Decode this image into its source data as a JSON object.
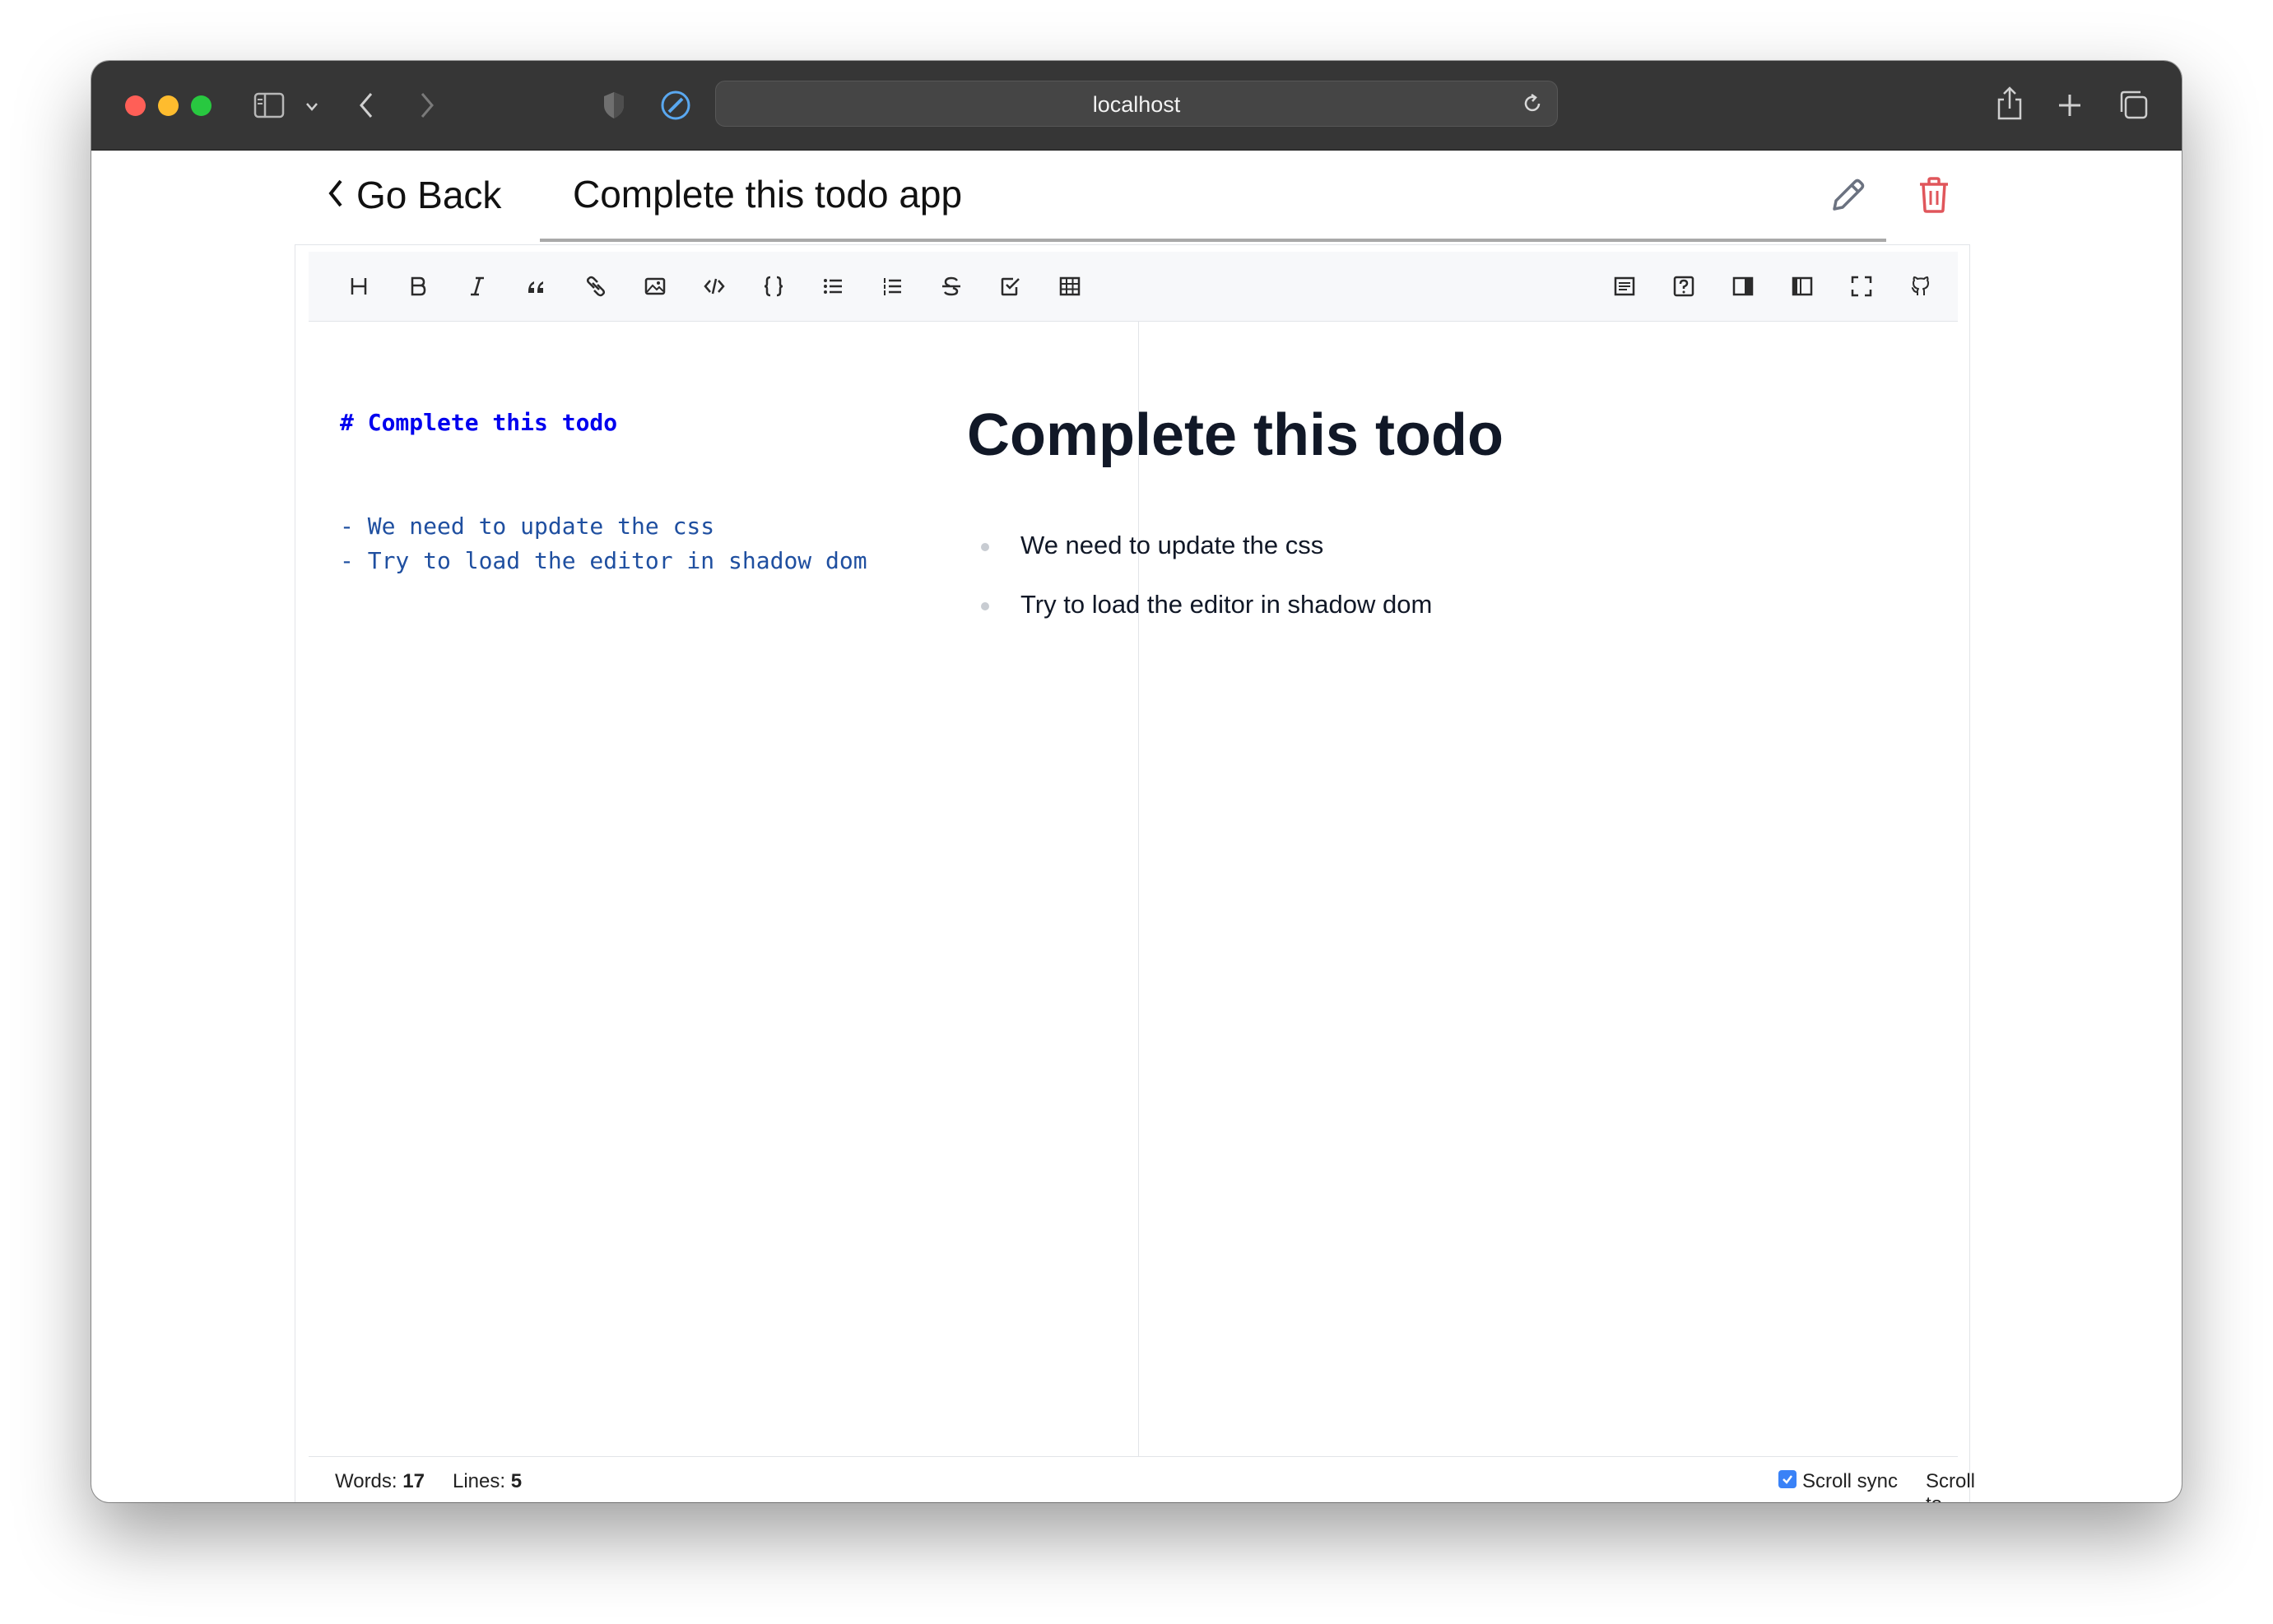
{
  "browser": {
    "url": "localhost",
    "traffic_lights": [
      "#ff5f57",
      "#febc2e",
      "#28c840"
    ],
    "icons": [
      "sidebar-icon",
      "chevron-down-icon",
      "back-icon",
      "forward-icon",
      "shield-icon",
      "compass-icon",
      "reload-icon",
      "share-icon",
      "new-tab-icon",
      "tab-overview-icon"
    ]
  },
  "header": {
    "back_label": "Go Back",
    "title": "Complete this todo app",
    "actions": [
      "pencil-icon",
      "trash-icon"
    ],
    "trash_color": "#e0565b"
  },
  "toolbar": {
    "left": [
      "heading-icon",
      "bold-icon",
      "italic-icon",
      "quote-icon",
      "link-icon",
      "image-icon",
      "code-icon",
      "code-block-icon",
      "unordered-list-icon",
      "ordered-list-icon",
      "strikethrough-icon",
      "task-list-icon",
      "table-icon"
    ],
    "right": [
      "preview-icon",
      "help-icon",
      "side-by-side-icon",
      "editor-only-icon",
      "fullscreen-icon",
      "github-icon"
    ]
  },
  "source": {
    "lines": [
      "# Complete this todo",
      "",
      "",
      "- We need to update the css",
      "- Try to load the editor in shadow dom"
    ]
  },
  "preview": {
    "heading": "Complete this todo",
    "items": [
      "We need to update the css",
      "Try to load the editor in shadow dom"
    ]
  },
  "status": {
    "words_label": "Words:",
    "words_value": "17",
    "lines_label": "Lines:",
    "lines_value": "5",
    "scroll_sync_label": "Scroll sync",
    "scroll_sync_checked": true,
    "scroll_top_label": "Scroll to top"
  }
}
